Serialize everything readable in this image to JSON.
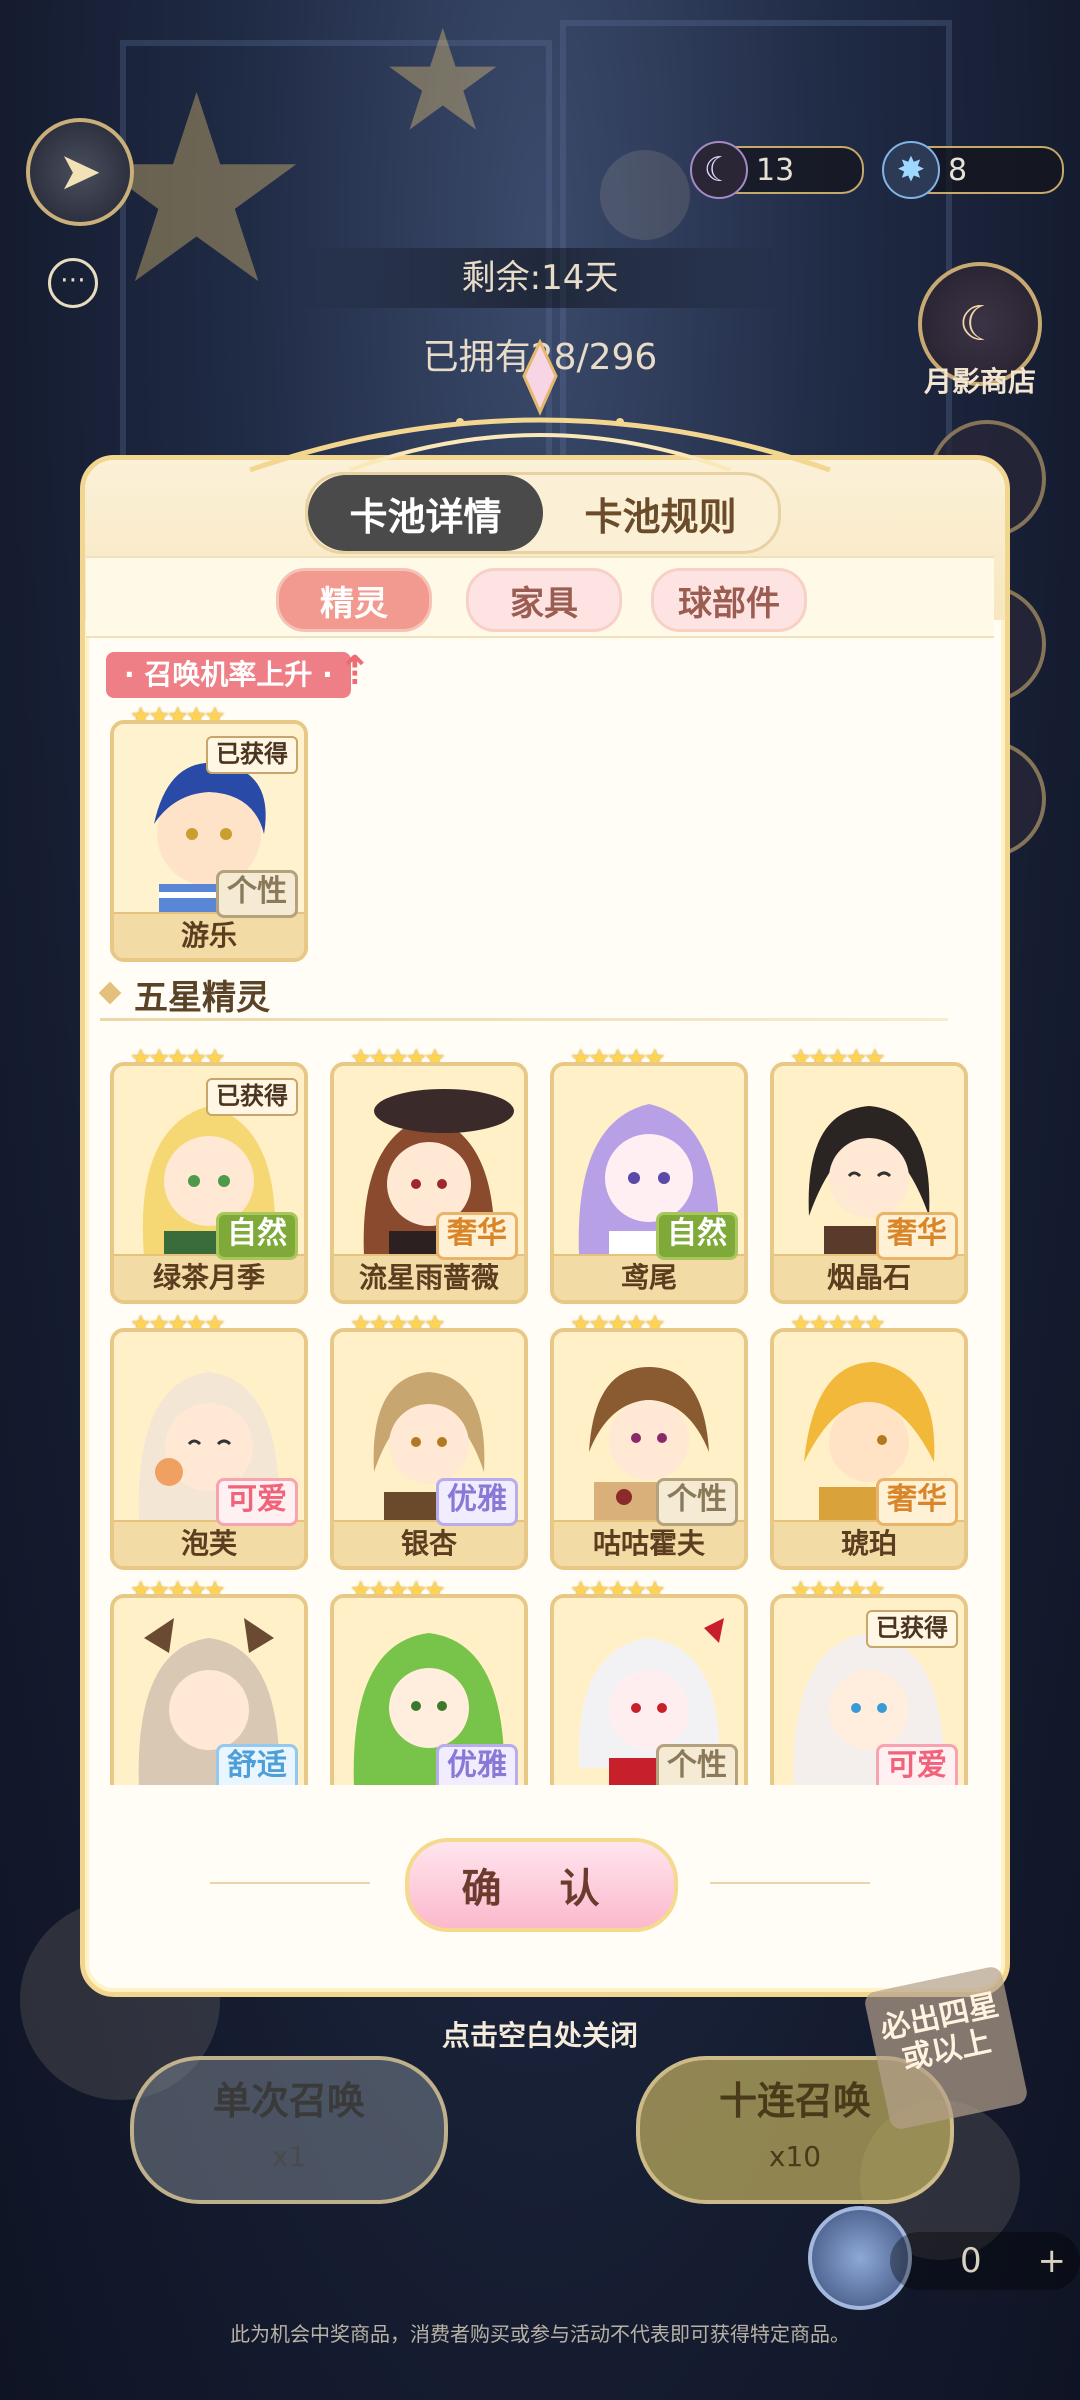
{
  "topbar": {
    "moon_count": "13",
    "crystal_count": "8",
    "remaining": "剩余:14天",
    "owned": "已拥有28/296",
    "shop_label": "月影商店"
  },
  "tabs": [
    {
      "label": "卡池详情",
      "active": true
    },
    {
      "label": "卡池规则",
      "active": false
    }
  ],
  "subtabs": [
    {
      "label": "精灵",
      "active": true
    },
    {
      "label": "家具",
      "active": false
    },
    {
      "label": "球部件",
      "active": false
    }
  ],
  "rateup": {
    "label": "· 召唤机率上升 ·",
    "card": {
      "name": "游乐",
      "attr": "个性",
      "owned": "已获得",
      "stars": "★★★★★"
    }
  },
  "five_star": {
    "title": "五星精灵",
    "cards": [
      {
        "name": "绿茶月季",
        "attr": "自然",
        "owned": "已获得",
        "stars": "★★★★★"
      },
      {
        "name": "流星雨蔷薇",
        "attr": "奢华",
        "owned": "",
        "stars": "★★★★★"
      },
      {
        "name": "鸢尾",
        "attr": "自然",
        "owned": "",
        "stars": "★★★★★"
      },
      {
        "name": "烟晶石",
        "attr": "奢华",
        "owned": "",
        "stars": "★★★★★"
      },
      {
        "name": "泡芙",
        "attr": "可爱",
        "owned": "",
        "stars": "★★★★★"
      },
      {
        "name": "银杏",
        "attr": "优雅",
        "owned": "",
        "stars": "★★★★★"
      },
      {
        "name": "咕咕霍夫",
        "attr": "个性",
        "owned": "",
        "stars": "★★★★★"
      },
      {
        "name": "琥珀",
        "attr": "奢华",
        "owned": "",
        "stars": "★★★★★"
      },
      {
        "name": "",
        "attr": "舒适",
        "owned": "",
        "stars": "★★★★★"
      },
      {
        "name": "",
        "attr": "优雅",
        "owned": "",
        "stars": "★★★★★"
      },
      {
        "name": "",
        "attr": "个性",
        "owned": "",
        "stars": "★★★★★"
      },
      {
        "name": "",
        "attr": "可爱",
        "owned": "已获得",
        "stars": "★★★★★"
      }
    ]
  },
  "confirm_label": "确 认",
  "close_hint": "点击空白处关闭",
  "summon": {
    "single_label": "单次召唤",
    "single_cost": "x1",
    "ten_label": "十连召唤",
    "ten_cost": "x10",
    "guarantee": "必出四星或以上"
  },
  "draw_tickets": "0",
  "disclaimer": "此为机会中奖商品，消费者购买或参与活动不代表即可获得特定商品。",
  "colors": {
    "accent_pink": "#f29a8f",
    "panel_border": "#f2d58f",
    "tab_active": "#4a4a4a"
  }
}
